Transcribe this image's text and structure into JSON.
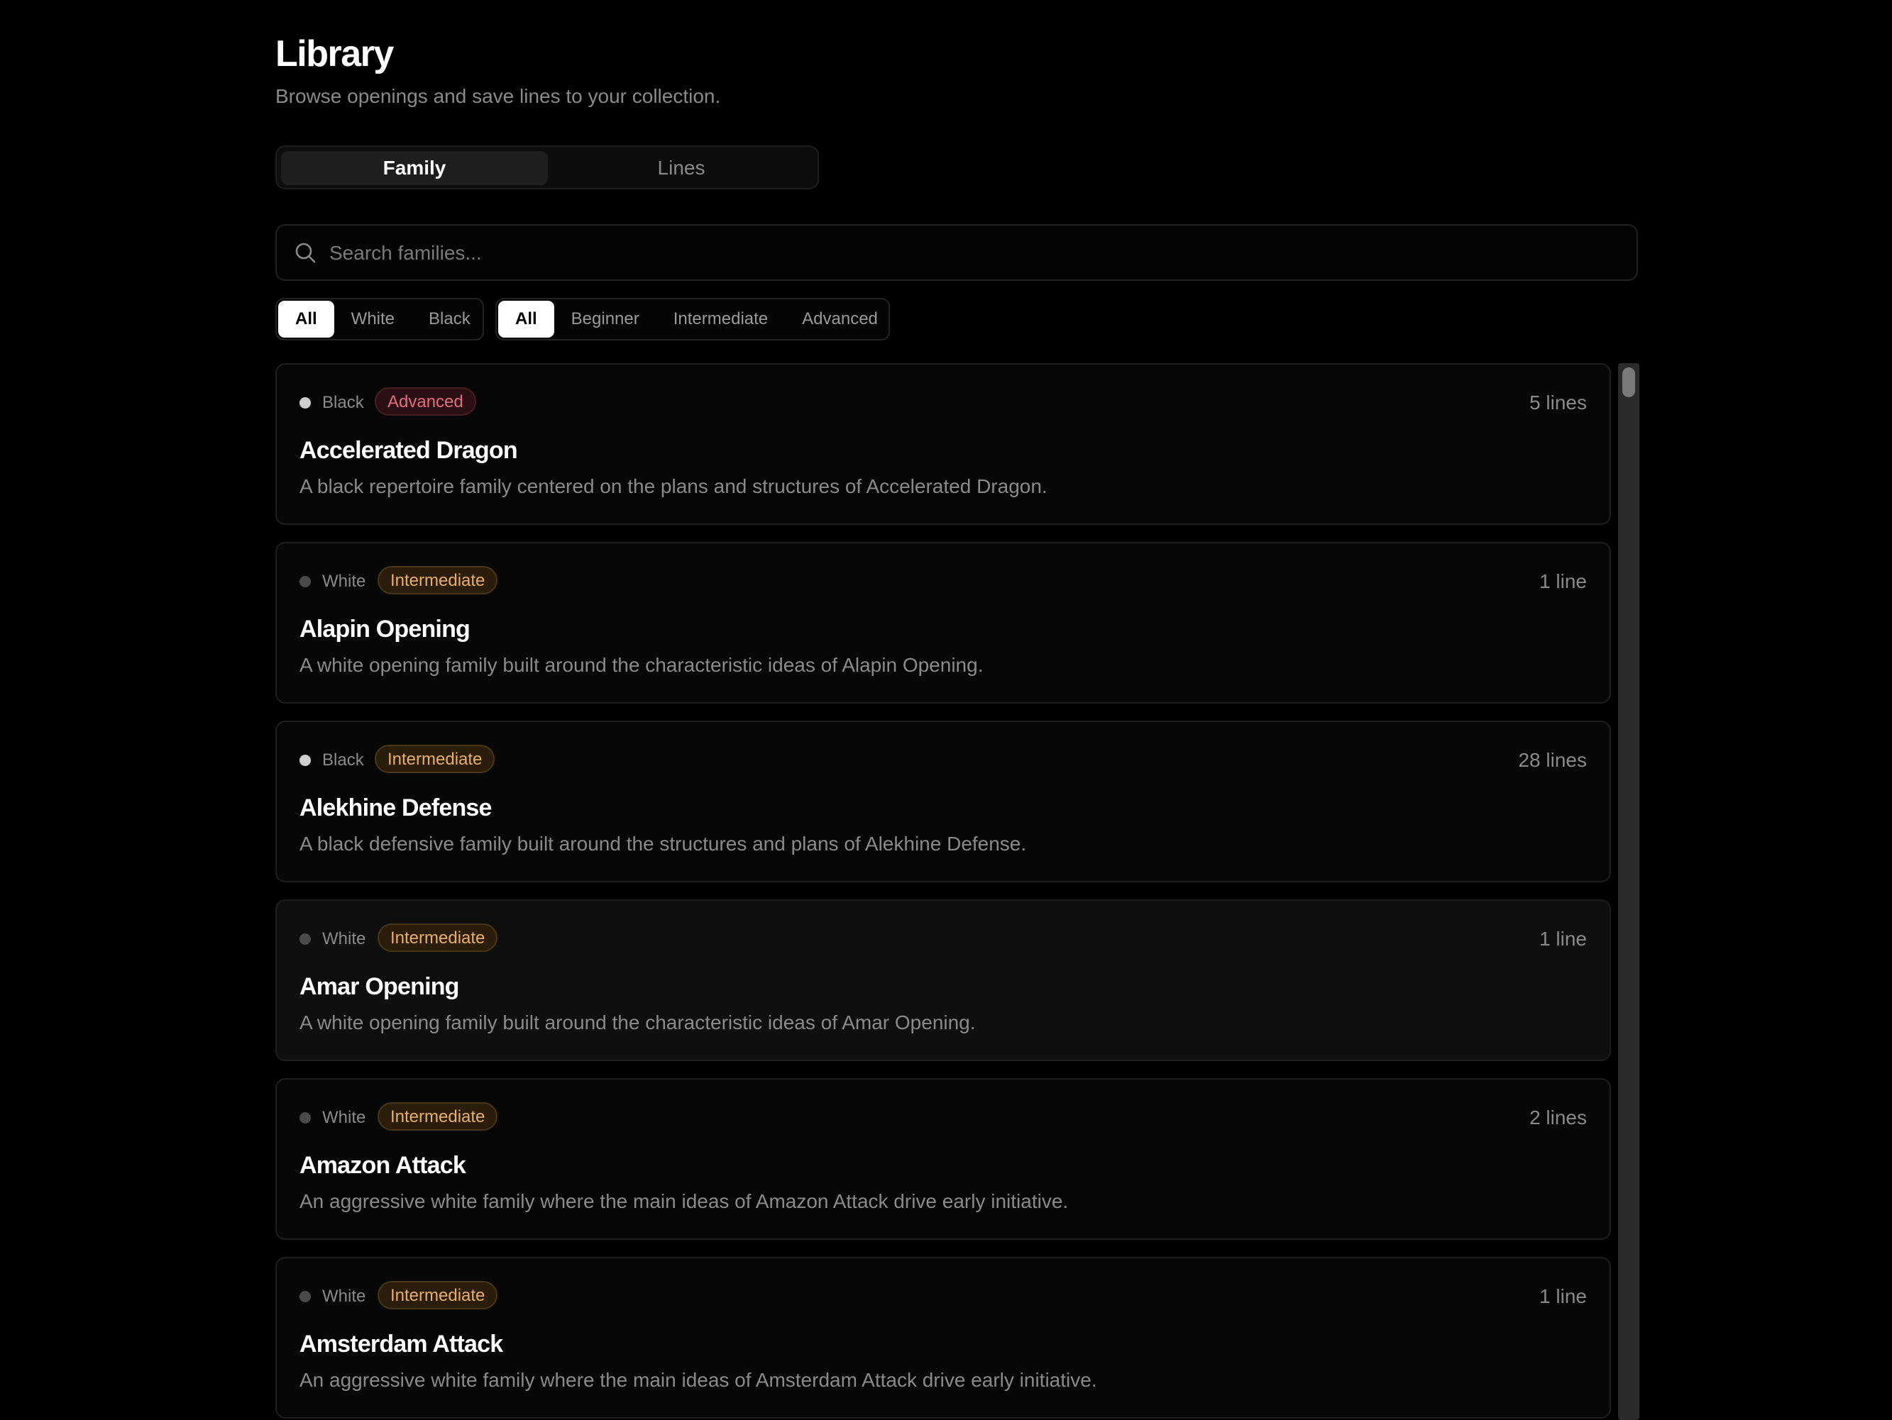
{
  "header": {
    "title": "Library",
    "subtitle": "Browse openings and save lines to your collection."
  },
  "view_toggle": {
    "options": [
      "Family",
      "Lines"
    ],
    "selected": "Family"
  },
  "search": {
    "placeholder": "Search families...",
    "value": ""
  },
  "side_filter": {
    "options": [
      "All",
      "White",
      "Black"
    ],
    "selected": "All"
  },
  "level_filter": {
    "options": [
      "All",
      "Beginner",
      "Intermediate",
      "Advanced"
    ],
    "selected": "All"
  },
  "colors": {
    "white_dot": "#4a4a4a",
    "black_dot": "#cfcfcf",
    "advanced": "#e46d7d",
    "intermediate": "#e8b062"
  },
  "families": [
    {
      "side": "Black",
      "level": "Advanced",
      "count": "5 lines",
      "name": "Accelerated Dragon",
      "description": "A black repertoire family centered on the plans and structures of Accelerated Dragon."
    },
    {
      "side": "White",
      "level": "Intermediate",
      "count": "1 line",
      "name": "Alapin Opening",
      "description": "A white opening family built around the characteristic ideas of Alapin Opening."
    },
    {
      "side": "Black",
      "level": "Intermediate",
      "count": "28 lines",
      "name": "Alekhine Defense",
      "description": "A black defensive family built around the structures and plans of Alekhine Defense."
    },
    {
      "side": "White",
      "level": "Intermediate",
      "count": "1 line",
      "name": "Amar Opening",
      "description": "A white opening family built around the characteristic ideas of Amar Opening."
    },
    {
      "side": "White",
      "level": "Intermediate",
      "count": "2 lines",
      "name": "Amazon Attack",
      "description": "An aggressive white family where the main ideas of Amazon Attack drive early initiative."
    },
    {
      "side": "White",
      "level": "Intermediate",
      "count": "1 line",
      "name": "Amsterdam Attack",
      "description": "An aggressive white family where the main ideas of Amsterdam Attack drive early initiative."
    }
  ]
}
